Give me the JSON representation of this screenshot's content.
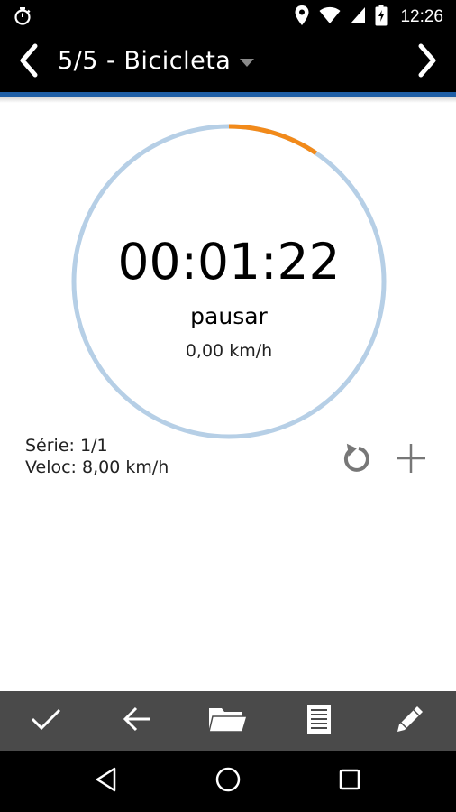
{
  "status_bar": {
    "time": "12:26",
    "icons": [
      "stopwatch-icon",
      "location-icon",
      "wifi-icon",
      "signal-icon",
      "battery-charging-icon"
    ]
  },
  "header": {
    "title": "5/5 - Bicicleta",
    "prev_icon": "chevron-left-icon",
    "next_icon": "chevron-right-icon",
    "accent_color": "#1f5fa6"
  },
  "timer": {
    "time": "00:01:22",
    "action_label": "pausar",
    "speed": "0,00 km/h",
    "progress_fraction": 0.095,
    "progress_color": "#f28a1a",
    "track_color": "#b6cfe6"
  },
  "info": {
    "series": "Série: 1/1",
    "speed": "Veloc: 8,00 km/h"
  },
  "actions": {
    "reset_icon": "reset-icon",
    "add_icon": "plus-icon"
  },
  "toolbar": {
    "items": [
      "check-icon",
      "back-arrow-icon",
      "folder-icon",
      "document-icon",
      "pencil-icon"
    ],
    "background": "#4a4a4a"
  },
  "navbar": {
    "items": [
      "back-triangle-icon",
      "home-circle-icon",
      "recents-square-icon"
    ]
  }
}
